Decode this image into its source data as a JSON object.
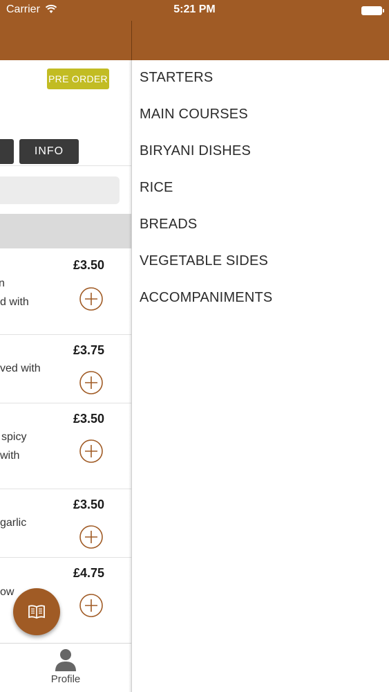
{
  "status_bar": {
    "carrier": "Carrier",
    "time": "5:21 PM"
  },
  "colors": {
    "header": "#a05b25",
    "preorder": "#c2bc23",
    "tab": "#3a3a3a"
  },
  "left": {
    "preorder_label": "PRE ORDER",
    "info_tab_label": "INFO",
    "items": [
      {
        "price": "£3.50",
        "lines": [
          "n",
          "d with"
        ]
      },
      {
        "price": "£3.75",
        "lines": [
          "ved with"
        ]
      },
      {
        "price": "£3.50",
        "lines": [
          "spicy",
          "with"
        ]
      },
      {
        "price": "£3.50",
        "lines": [
          "garlic"
        ]
      },
      {
        "price": "£4.75",
        "lines": [
          "ow"
        ]
      }
    ],
    "tabbar": {
      "profile_label": "Profile"
    }
  },
  "drawer": {
    "categories": [
      "STARTERS",
      "MAIN COURSES",
      "BIRYANI DISHES",
      "RICE",
      "BREADS",
      "VEGETABLE SIDES",
      "ACCOMPANIMENTS"
    ]
  }
}
